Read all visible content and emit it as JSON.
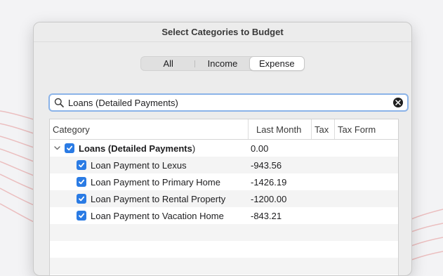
{
  "dialog": {
    "title": "Select Categories to Budget"
  },
  "filter": {
    "options": [
      "All",
      "Income",
      "Expense"
    ],
    "selected": "Expense"
  },
  "search": {
    "value": "Loans (Detailed Payments)",
    "icon": "magnifier-icon",
    "clear_icon": "clear-x-icon"
  },
  "table": {
    "columns": {
      "category": "Category",
      "last_month": "Last Month",
      "tax": "Tax",
      "tax_form": "Tax Form"
    },
    "parent": {
      "name": "Loans (Detailed Payments",
      "name_suffix": ")",
      "last_month": "0.00",
      "checked": true,
      "expanded": true
    },
    "children": [
      {
        "name": "Loan Payment to Lexus",
        "last_month": "-943.56",
        "checked": true
      },
      {
        "name": "Loan Payment to Primary Home",
        "last_month": "-1426.19",
        "checked": true
      },
      {
        "name": "Loan Payment to Rental Property",
        "last_month": "-1200.00",
        "checked": true
      },
      {
        "name": "Loan Payment to Vacation Home",
        "last_month": "-843.21",
        "checked": true
      }
    ]
  },
  "colors": {
    "accent": "#2a7be4",
    "focus_ring": "#8bb3e8",
    "background_lines": "#e8a3a3"
  }
}
